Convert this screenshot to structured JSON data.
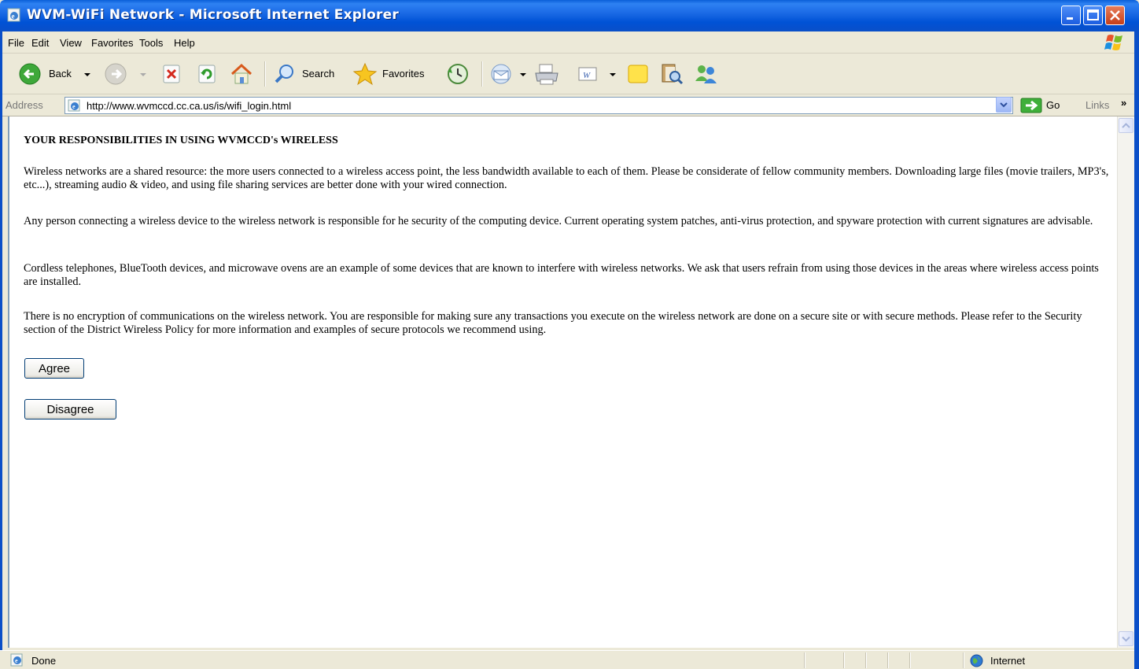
{
  "window": {
    "title": "WVM-WiFi Network - Microsoft Internet Explorer"
  },
  "menu": {
    "items": [
      "File",
      "Edit",
      "View",
      "Favorites",
      "Tools",
      "Help"
    ]
  },
  "toolbar": {
    "back_label": "Back",
    "search_label": "Search",
    "favorites_label": "Favorites"
  },
  "address": {
    "label": "Address",
    "url": "http://www.wvmccd.cc.ca.us/is/wifi_login.html",
    "go_label": "Go",
    "links_label": "Links",
    "links_chevron": "»"
  },
  "page": {
    "heading": "YOUR RESPONSIBILITIES IN USING WVMCCD's WIRELESS",
    "paragraphs": [
      "Wireless networks are a shared resource: the more users connected to a wireless access point, the less bandwidth available to each of them. Please be considerate of fellow community members. Downloading large files (movie trailers, MP3's, etc...), streaming audio & video, and using file sharing services are better done with your wired connection.",
      "Any person connecting a wireless device to the wireless network is responsible for he security of the computing device. Current operating system patches, anti-virus protection, and spyware protection with current signatures are advisable.",
      "Cordless telephones, BlueTooth devices, and microwave ovens are an example of some devices that are known to interfere with wireless networks. We ask that users refrain from using those devices in the areas where wireless access points are installed.",
      "There is no encryption of communications on the wireless network. You are responsible for making sure any transactions you execute on the wireless network are done on a secure site or with secure methods. Please refer to the Security section of the District Wireless Policy for more information and examples of secure protocols we recommend using."
    ],
    "agree_label": "Agree",
    "disagree_label": "Disagree"
  },
  "status": {
    "text": "Done",
    "zone": "Internet"
  },
  "colors": {
    "titlebar": "#0A5FD8",
    "chrome": "#ECE9D8",
    "content_bg": "#FFFFFF",
    "button_border": "#003C74"
  },
  "icons": [
    "ie-page-icon",
    "windows-flag-icon",
    "back-arrow-icon",
    "forward-arrow-icon",
    "stop-icon",
    "refresh-icon",
    "home-icon",
    "search-icon",
    "favorites-star-icon",
    "history-icon",
    "mail-icon",
    "print-icon",
    "word-edit-icon",
    "note-icon",
    "research-icon",
    "messenger-icon",
    "go-arrow-icon",
    "internet-globe-icon"
  ]
}
